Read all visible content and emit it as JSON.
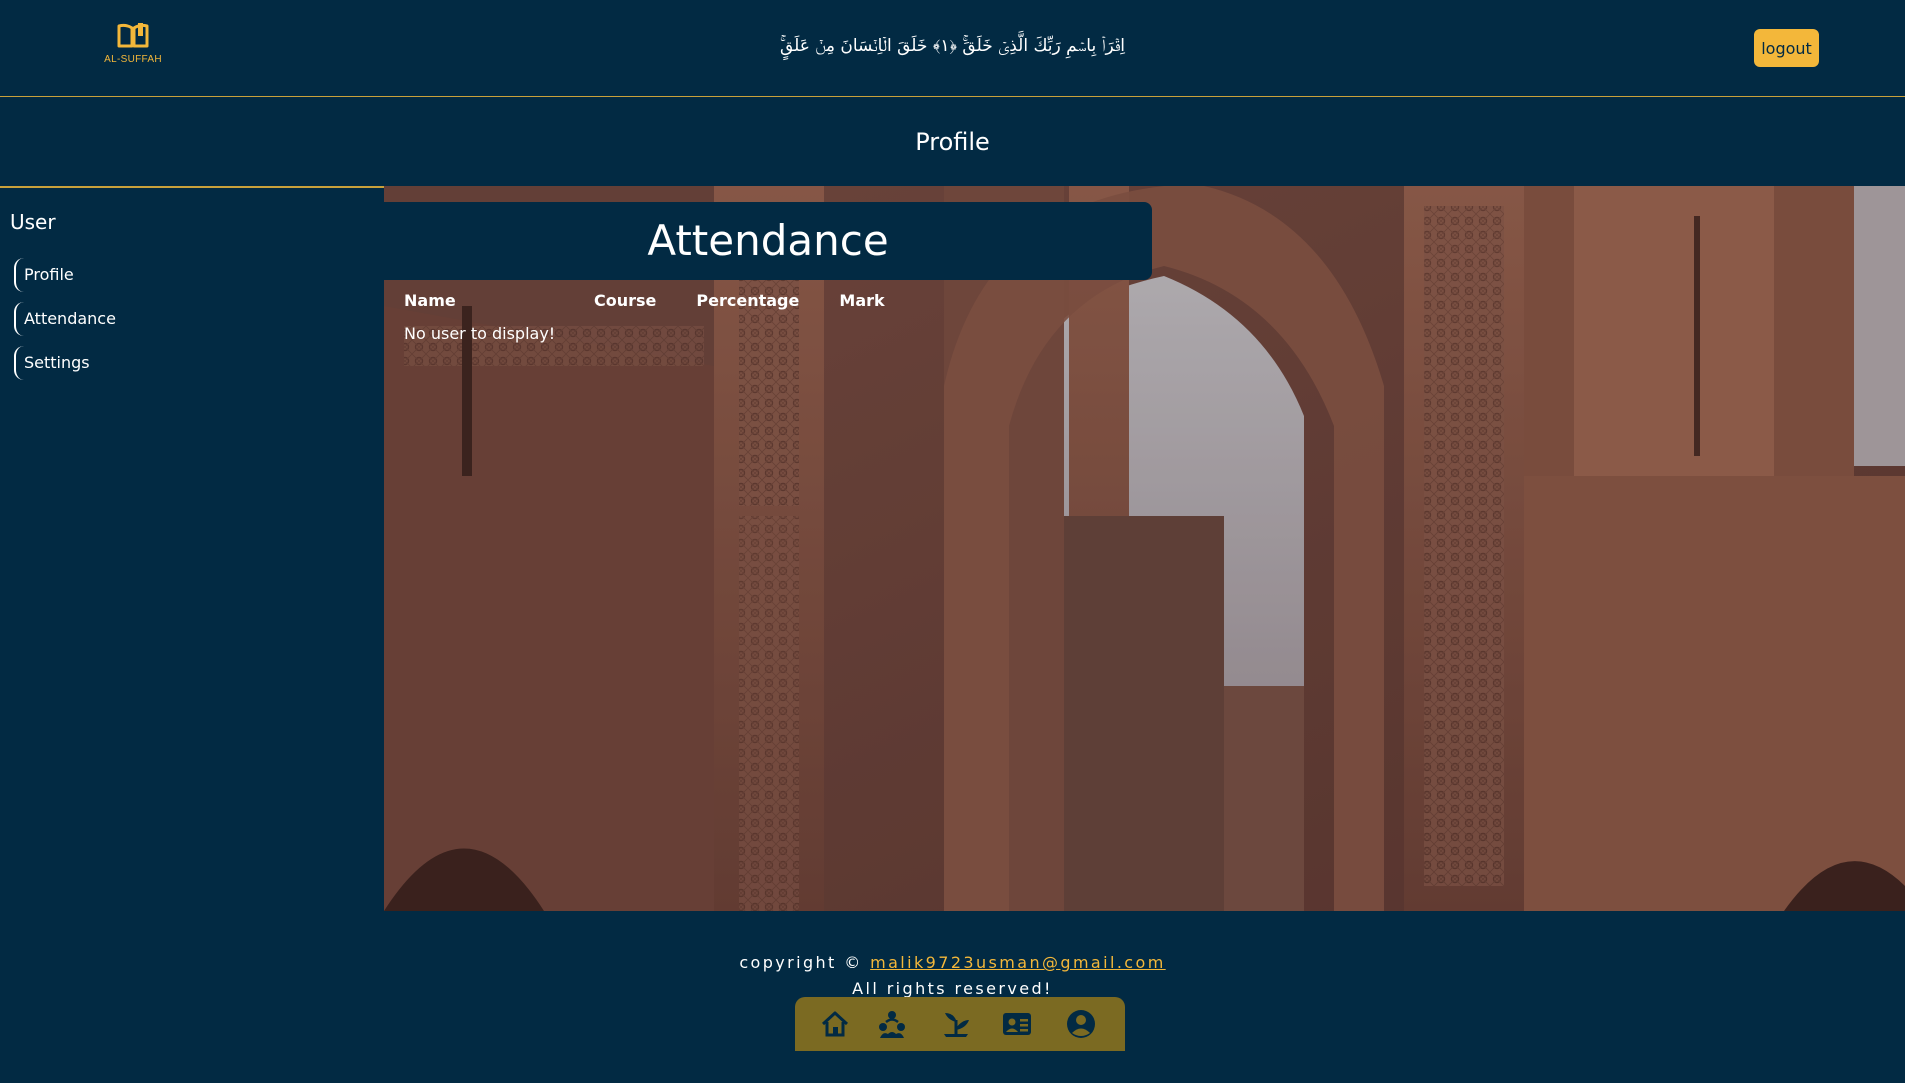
{
  "header": {
    "logo_text": "AL-SUFFAH",
    "verse": "اِقۡرَاۡ بِاسۡمِ رَبِّكَ الَّذِىۡ خَلَقَ‌ۚ‏ ﴿۱﴾ خَلَقَ الۡاِنۡسَانَ مِنۡ عَلَقٍ‌ۚ",
    "logout_label": "logout"
  },
  "page": {
    "title": "Profile"
  },
  "sidebar": {
    "title": "User",
    "items": [
      {
        "label": "Profile"
      },
      {
        "label": "Attendance"
      },
      {
        "label": "Settings"
      }
    ]
  },
  "main": {
    "heading": "Attendance",
    "table": {
      "columns": [
        "Name",
        "Course",
        "Percentage",
        "Mark"
      ],
      "empty_message": "No user to display!"
    }
  },
  "footer": {
    "copyright_prefix": "copyright ©",
    "email": "malik9723usman@gmail.com",
    "rights": "All rights reserved!"
  },
  "bottom_nav": {
    "icons": [
      "home-icon",
      "community-icon",
      "growth-icon",
      "contact-card-icon",
      "account-icon"
    ]
  },
  "colors": {
    "background": "#022a43",
    "accent": "#f3b73a",
    "nav_bar": "#7b6a22",
    "divider": "#c9a13b"
  }
}
